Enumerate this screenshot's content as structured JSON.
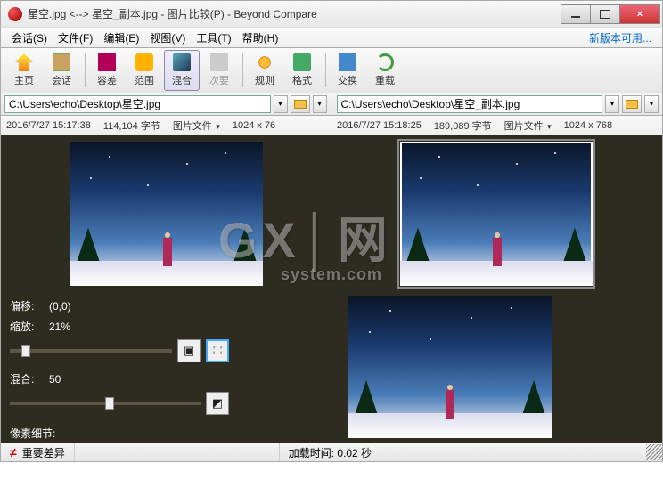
{
  "window": {
    "title": "星空.jpg <--> 星空_副本.jpg - 图片比较(P) - Beyond Compare"
  },
  "update_link": "新版本可用...",
  "menu": {
    "session": "会话(S)",
    "file": "文件(F)",
    "edit": "编辑(E)",
    "view": "视图(V)",
    "tools": "工具(T)",
    "help": "帮助(H)"
  },
  "toolbar": {
    "home": "主页",
    "session": "会话",
    "diff": "容差",
    "range": "范围",
    "blend": "混合",
    "minor": "次要",
    "rules": "规则",
    "format": "格式",
    "swap": "交换",
    "reload": "重载"
  },
  "paths": {
    "left": "C:\\Users\\echo\\Desktop\\星空.jpg",
    "right": "C:\\Users\\echo\\Desktop\\星空_副本.jpg"
  },
  "meta": {
    "left_time": "2016/7/27 15:17:38",
    "left_size": "114,104 字节",
    "left_type": "图片文件",
    "left_dims": "1024 x 76",
    "right_time": "2016/7/27 15:18:25",
    "right_size": "189,089 字节",
    "right_type": "图片文件",
    "right_dims": "1024 x 768"
  },
  "controls": {
    "offset_label": "偏移:",
    "offset_value": "(0,0)",
    "zoom_label": "缩放:",
    "zoom_value": "21%",
    "zoom_slider_pct": 7,
    "blend_label": "混合:",
    "blend_value": "50",
    "blend_slider_pct": 50,
    "pixel_label": "像素细节:"
  },
  "status": {
    "important_diff": "重要差异",
    "load_time": "加载时间: 0.02 秒"
  },
  "watermark": {
    "main": "GX│网",
    "sub": "system.com"
  }
}
